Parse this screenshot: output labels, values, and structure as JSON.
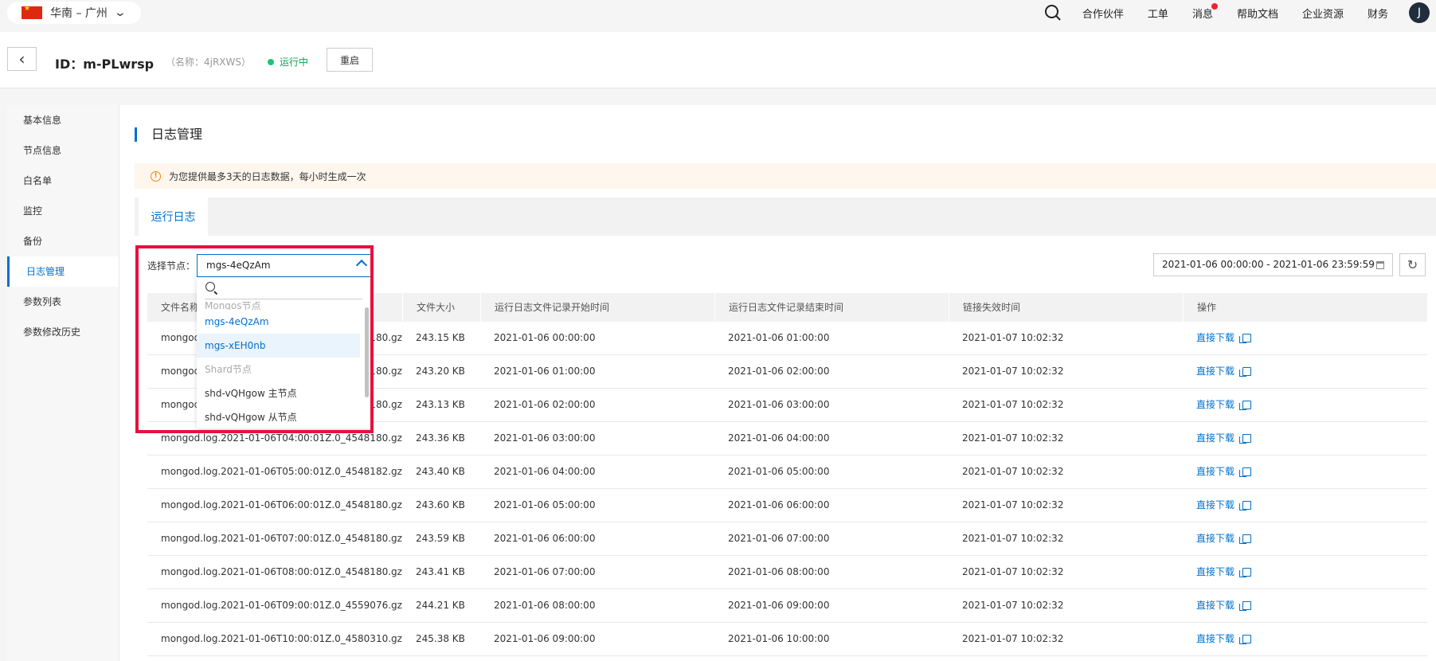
{
  "topbar": {
    "region": "华南 – 广州",
    "nav": [
      "合作伙伴",
      "工单",
      "消息",
      "帮助文档",
      "企业资源",
      "财务"
    ],
    "avatar_initial": "J"
  },
  "header": {
    "title": "ID：m-PLwrsp",
    "alias": "（名称：4jRXWS）",
    "status": "运行中",
    "restart": "重启"
  },
  "sidebar": {
    "items": [
      {
        "label": "基本信息"
      },
      {
        "label": "节点信息"
      },
      {
        "label": "白名单"
      },
      {
        "label": "监控"
      },
      {
        "label": "备份"
      },
      {
        "label": "日志管理"
      },
      {
        "label": "参数列表"
      },
      {
        "label": "参数修改历史"
      }
    ],
    "active_index": 5
  },
  "main": {
    "section_title": "日志管理",
    "notice": "为您提供最多3天的日志数据，每小时生成一次",
    "tab": "运行日志",
    "node_label": "选择节点：",
    "selected_node": "mgs-4eQzAm",
    "date_range": "2021-01-06 00:00:00 - 2021-01-06 23:59:59"
  },
  "dropdown": {
    "search_placeholder": "",
    "items": [
      {
        "label": "Mongos节点",
        "kind": "group"
      },
      {
        "label": "mgs-4eQzAm",
        "kind": "selected"
      },
      {
        "label": "mgs-xEH0nb",
        "kind": "hover"
      },
      {
        "label": "Shard节点",
        "kind": "group"
      },
      {
        "label": "shd-vQHgow 主节点",
        "kind": "option"
      },
      {
        "label": "shd-vQHgow 从节点",
        "kind": "option"
      }
    ]
  },
  "table": {
    "headers": [
      "文件名称",
      "文件大小",
      "运行日志文件记录开始时间",
      "运行日志文件记录结束时间",
      "链接失效时间",
      "操作"
    ],
    "action_label": "直接下载",
    "rows": [
      {
        "name": "mongod.log.2021-01-06T01:00:01Z.0_4548180.gz",
        "size": "243.15 KB",
        "start": "2021-01-06 00:00:00",
        "end": "2021-01-06 01:00:00",
        "expire": "2021-01-07 10:02:32"
      },
      {
        "name": "mongod.log.2021-01-06T02:00:01Z.0_4548180.gz",
        "size": "243.20 KB",
        "start": "2021-01-06 01:00:00",
        "end": "2021-01-06 02:00:00",
        "expire": "2021-01-07 10:02:32"
      },
      {
        "name": "mongod.log.2021-01-06T03:00:01Z.0_4548180.gz",
        "size": "243.13 KB",
        "start": "2021-01-06 02:00:00",
        "end": "2021-01-06 03:00:00",
        "expire": "2021-01-07 10:02:32"
      },
      {
        "name": "mongod.log.2021-01-06T04:00:01Z.0_4548180.gz",
        "size": "243.36 KB",
        "start": "2021-01-06 03:00:00",
        "end": "2021-01-06 04:00:00",
        "expire": "2021-01-07 10:02:32"
      },
      {
        "name": "mongod.log.2021-01-06T05:00:01Z.0_4548182.gz",
        "size": "243.40 KB",
        "start": "2021-01-06 04:00:00",
        "end": "2021-01-06 05:00:00",
        "expire": "2021-01-07 10:02:32"
      },
      {
        "name": "mongod.log.2021-01-06T06:00:01Z.0_4548180.gz",
        "size": "243.60 KB",
        "start": "2021-01-06 05:00:00",
        "end": "2021-01-06 06:00:00",
        "expire": "2021-01-07 10:02:32"
      },
      {
        "name": "mongod.log.2021-01-06T07:00:01Z.0_4548180.gz",
        "size": "243.59 KB",
        "start": "2021-01-06 06:00:00",
        "end": "2021-01-06 07:00:00",
        "expire": "2021-01-07 10:02:32"
      },
      {
        "name": "mongod.log.2021-01-06T08:00:01Z.0_4548180.gz",
        "size": "243.41 KB",
        "start": "2021-01-06 07:00:00",
        "end": "2021-01-06 08:00:00",
        "expire": "2021-01-07 10:02:32"
      },
      {
        "name": "mongod.log.2021-01-06T09:00:01Z.0_4559076.gz",
        "size": "244.21 KB",
        "start": "2021-01-06 08:00:00",
        "end": "2021-01-06 09:00:00",
        "expire": "2021-01-07 10:02:32"
      },
      {
        "name": "mongod.log.2021-01-06T10:00:01Z.0_4580310.gz",
        "size": "245.38 KB",
        "start": "2021-01-06 09:00:00",
        "end": "2021-01-06 10:00:00",
        "expire": "2021-01-07 10:02:32"
      }
    ]
  },
  "colors": {
    "accent": "#0070cc",
    "status_running": "#1ec374",
    "highlight_border": "#e8103f",
    "notice_bg": "#fff7ee"
  },
  "icons": [
    "china-flag-icon",
    "chevron-down-icon",
    "search-icon",
    "chevron-left-icon",
    "warning-icon",
    "chevron-up-icon",
    "calendar-icon",
    "refresh-icon",
    "copy-icon"
  ]
}
